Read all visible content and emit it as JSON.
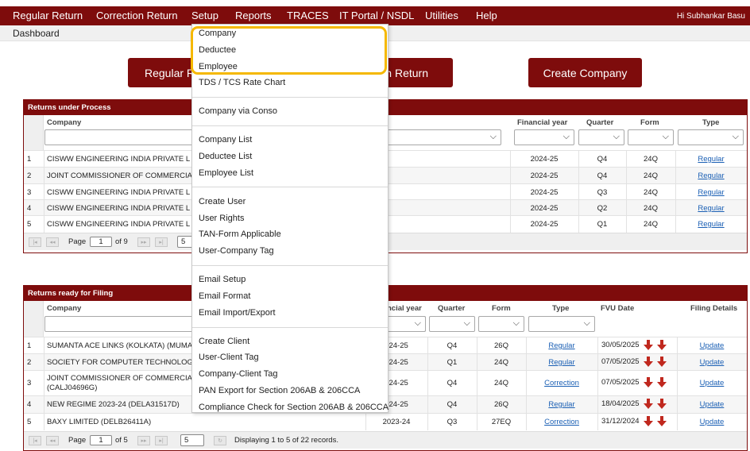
{
  "nav": {
    "items": [
      "Regular Return",
      "Correction Return",
      "Setup",
      "Reports",
      "TRACES",
      "IT Portal / NSDL",
      "Utilities",
      "Help"
    ],
    "greeting": "Hi Subhankar Basu"
  },
  "subnav": {
    "label": "Dashboard"
  },
  "buttons": {
    "regular": "Regular R",
    "correction": "n Return",
    "create_company": "Create Company"
  },
  "setup_menu": {
    "items": [
      "Company",
      "Deductee",
      "Employee",
      "TDS / TCS Rate Chart",
      "Company via Conso",
      "Company List",
      "Deductee List",
      "Employee List",
      "Create User",
      "User Rights",
      "TAN-Form Applicable",
      "User-Company Tag",
      "Email Setup",
      "Email Format",
      "Email Import/Export",
      "Create Client",
      "User-Client Tag",
      "Company-Client Tag",
      "PAN Export for Section 206AB & 206CCA",
      "Compliance Check for Section 206AB & 206CCA"
    ]
  },
  "process_panel": {
    "title": "Returns under Process",
    "columns": {
      "company": "Company",
      "fy": "Financial year",
      "quarter": "Quarter",
      "form": "Form",
      "type": "Type"
    },
    "rows": [
      {
        "no": "1",
        "company": "CISWW ENGINEERING INDIA PRIVATE L",
        "fy": "2024-25",
        "quarter": "Q4",
        "form": "24Q",
        "type": "Regular"
      },
      {
        "no": "2",
        "company": "JOINT COMMISSIONER OF COMMERCIA",
        "fy": "2024-25",
        "quarter": "Q4",
        "form": "24Q",
        "type": "Regular"
      },
      {
        "no": "3",
        "company": "CISWW ENGINEERING INDIA PRIVATE L",
        "fy": "2024-25",
        "quarter": "Q3",
        "form": "24Q",
        "type": "Regular"
      },
      {
        "no": "4",
        "company": "CISWW ENGINEERING INDIA PRIVATE L",
        "fy": "2024-25",
        "quarter": "Q2",
        "form": "24Q",
        "type": "Regular"
      },
      {
        "no": "5",
        "company": "CISWW ENGINEERING INDIA PRIVATE L",
        "fy": "2024-25",
        "quarter": "Q1",
        "form": "24Q",
        "type": "Regular"
      }
    ],
    "pager": {
      "page_label": "Page",
      "page": "1",
      "of": "of 9",
      "per_page": "5"
    }
  },
  "filing_panel": {
    "title": "Returns ready for Filing",
    "columns": {
      "company": "Company",
      "fy": "ncial year",
      "quarter": "Quarter",
      "form": "Form",
      "type": "Type",
      "fvu": "FVU Date",
      "details": "Filing Details"
    },
    "rows": [
      {
        "no": "1",
        "company": "SUMANTA ACE LINKS (KOLKATA) (MUMA",
        "company2": "",
        "fy": "024-25",
        "quarter": "Q4",
        "form": "26Q",
        "type": "Regular",
        "fvu": "30/05/2025",
        "details": "Update"
      },
      {
        "no": "2",
        "company": "SOCIETY FOR COMPUTER TECHNOLOG",
        "company2": "",
        "fy": "024-25",
        "quarter": "Q1",
        "form": "24Q",
        "type": "Regular",
        "fvu": "07/05/2025",
        "details": "Update"
      },
      {
        "no": "3",
        "company": "JOINT COMMISSIONER OF COMMERCIA",
        "company2": "(CALJ04696G)",
        "fy": "024-25",
        "quarter": "Q4",
        "form": "24Q",
        "type": "Correction",
        "fvu": "07/05/2025",
        "details": "Update"
      },
      {
        "no": "4",
        "company": "NEW REGIME 2023-24 (DELA31517D)",
        "company2": "",
        "fy": "024-25",
        "quarter": "Q4",
        "form": "26Q",
        "type": "Regular",
        "fvu": "18/04/2025",
        "details": "Update"
      },
      {
        "no": "5",
        "company": "BAXY LIMITED (DELB26411A)",
        "company2": "",
        "fy": "2023-24",
        "quarter": "Q3",
        "form": "27EQ",
        "type": "Correction",
        "fvu": "31/12/2024",
        "details": "Update"
      }
    ],
    "pager": {
      "page_label": "Page",
      "page": "1",
      "of": "of 5",
      "per_page": "5",
      "summary": "Displaying 1 to 5 of 22 records."
    }
  },
  "colors": {
    "brand": "#7e0c0c",
    "link": "#1a5fb4",
    "highlight": "#f5b800",
    "arrow": "#c0281e"
  }
}
